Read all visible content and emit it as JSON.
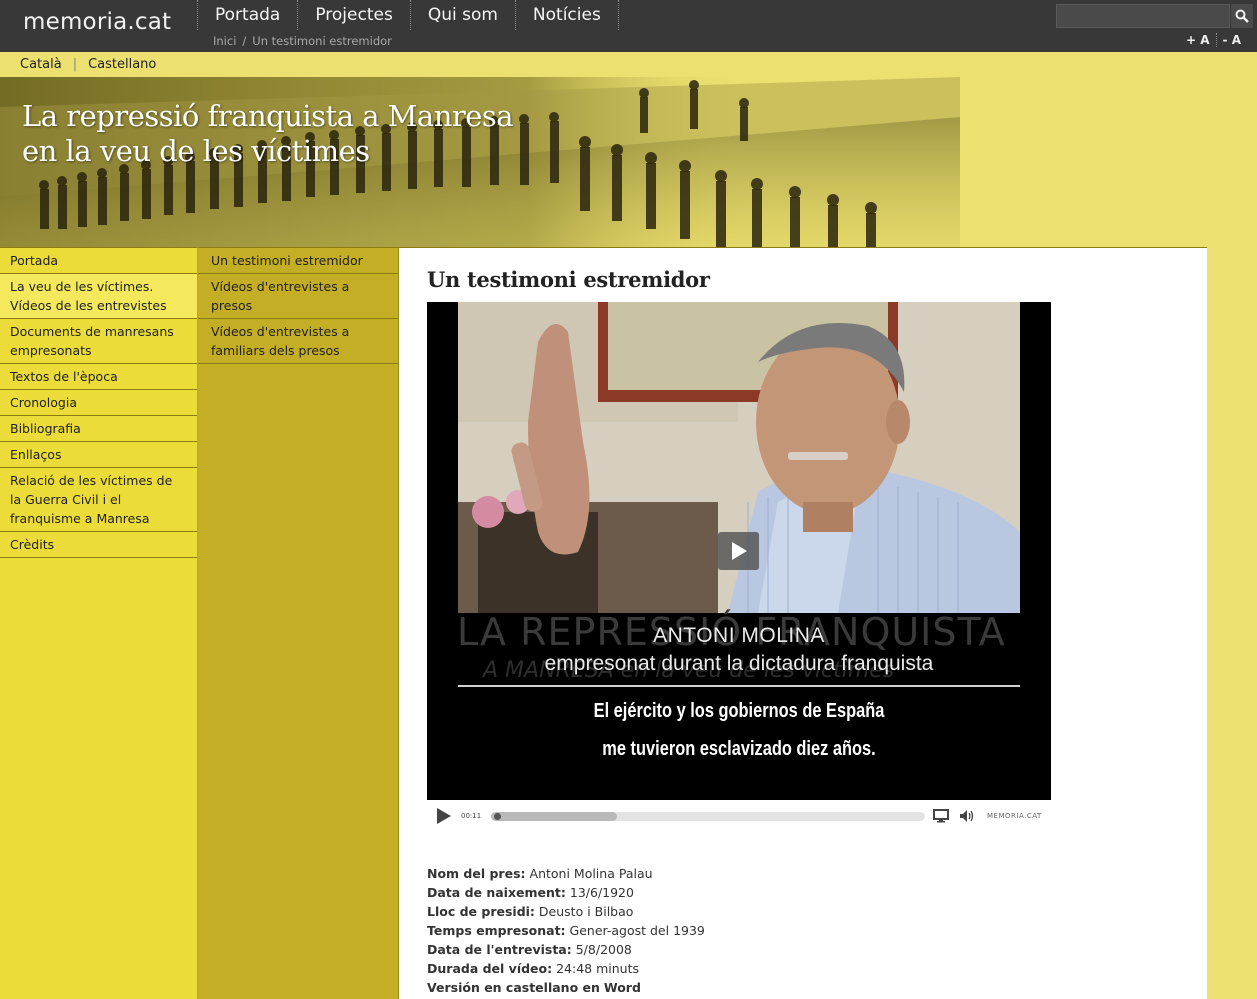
{
  "site": {
    "logo": "memoria.cat"
  },
  "main_nav": [
    "Portada",
    "Projectes",
    "Qui som",
    "Notícies"
  ],
  "breadcrumb": {
    "home": "Inici",
    "separator": "/",
    "current": "Un testimoni estremidor"
  },
  "search": {
    "placeholder": ""
  },
  "font_controls": {
    "increase": "+ A",
    "decrease": "- A"
  },
  "languages": [
    "Català",
    "Castellano"
  ],
  "banner": {
    "line1": "La repressió franquista a Manresa",
    "line2": "en la veu de les víctimes"
  },
  "sidebar": {
    "items": [
      "Portada",
      "La veu de les víctimes. Vídeos de les entrevistes",
      "Documents de manresans empresonats",
      "Textos de l'època",
      "Cronologia",
      "Bibliografia",
      "Enllaços",
      "Relació de les víctimes de la Guerra Civil i el franquisme a Manresa",
      "Crèdits"
    ],
    "active_index": 1
  },
  "subnav": {
    "items": [
      "Un testimoni estremidor",
      "Vídeos d'entrevistes a presos",
      "Vídeos d'entrevistes a familiars dels presos"
    ]
  },
  "content": {
    "title": "Un testimoni estremidor",
    "video": {
      "ghost_line1": "LA REPRESSIÓ FRANQUISTA",
      "ghost_line2": "A MANRESA en la veu de les víctimes",
      "name": "ANTONI MOLINA",
      "role": "empresonat durant la dictadura franquista",
      "subtitle_line1": "El ejército y los gobiernos de España",
      "subtitle_line2": "me tuvieron esclavizado diez años.",
      "time": "00:11",
      "brand": "MEMORIA.CAT",
      "progress": 0.29
    },
    "details": [
      {
        "label": "Nom del pres:",
        "value": "Antoni Molina Palau"
      },
      {
        "label": "Data de naixement:",
        "value": "13/6/1920"
      },
      {
        "label": "Lloc de presidi:",
        "value": "Deusto i Bilbao"
      },
      {
        "label": "Temps empresonat:",
        "value": "Gener-agost del 1939"
      },
      {
        "label": "Data de l'entrevista:",
        "value": "5/8/2008"
      },
      {
        "label": "Durada del vídeo:",
        "value": "24:48 minuts"
      },
      {
        "label": "Versión en castellano en",
        "value": "Word"
      }
    ]
  },
  "colors": {
    "topbar": "#383838",
    "page_yellow": "#ece070",
    "sidebar_yellow": "#ebdc3a",
    "subnav_olive": "#c3ae26",
    "content_bg": "#ffffff"
  }
}
